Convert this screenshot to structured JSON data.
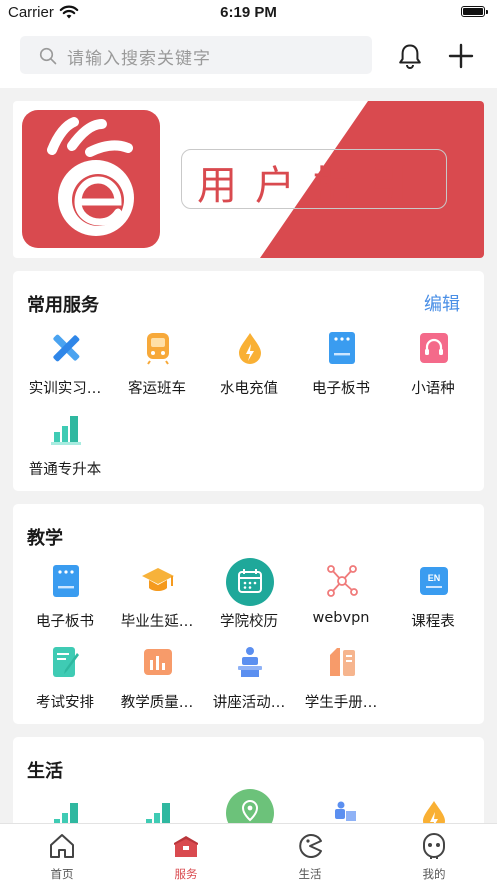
{
  "status_bar": {
    "carrier": "Carrier",
    "time": "6:19 PM"
  },
  "search": {
    "placeholder": "请输入搜索关键字"
  },
  "banner": {
    "title": "用户指引"
  },
  "sections": {
    "common": {
      "title": "常用服务",
      "action": "编辑",
      "items": [
        {
          "label": "实训实习…",
          "icon": "ruler-pencil-icon"
        },
        {
          "label": "客运班车",
          "icon": "train-icon"
        },
        {
          "label": "水电充值",
          "icon": "water-drop-bolt-icon"
        },
        {
          "label": "电子板书",
          "icon": "e-board-icon"
        },
        {
          "label": "小语种",
          "icon": "headset-icon"
        },
        {
          "label": "普通专升本",
          "icon": "bar-chart-icon"
        }
      ]
    },
    "teaching": {
      "title": "教学",
      "items": [
        {
          "label": "电子板书",
          "icon": "e-board-icon"
        },
        {
          "label": "毕业生延…",
          "icon": "graduation-cap-icon"
        },
        {
          "label": "学院校历",
          "icon": "calendar-icon"
        },
        {
          "label": "webvpn",
          "icon": "network-icon"
        },
        {
          "label": "课程表",
          "icon": "en-board-icon"
        },
        {
          "label": "考试安排",
          "icon": "exam-pen-icon"
        },
        {
          "label": "教学质量…",
          "icon": "quality-chart-icon"
        },
        {
          "label": "讲座活动…",
          "icon": "speaker-podium-icon"
        },
        {
          "label": "学生手册…",
          "icon": "handbook-icon"
        }
      ]
    },
    "life": {
      "title": "生活",
      "items": [
        {
          "icon": "bar-chart-icon"
        },
        {
          "icon": "bar-chart-icon"
        },
        {
          "icon": "map-pin-icon"
        },
        {
          "icon": "delivery-icon"
        },
        {
          "icon": "water-drop-bolt-icon"
        }
      ]
    }
  },
  "tabbar": {
    "tabs": [
      {
        "label": "首页",
        "icon": "home-icon"
      },
      {
        "label": "服务",
        "icon": "service-icon"
      },
      {
        "label": "生活",
        "icon": "pacman-icon"
      },
      {
        "label": "我的",
        "icon": "face-icon"
      }
    ],
    "active_index": 1
  },
  "colors": {
    "brand_red": "#d94a4f",
    "link_blue": "#4a8fe6"
  }
}
